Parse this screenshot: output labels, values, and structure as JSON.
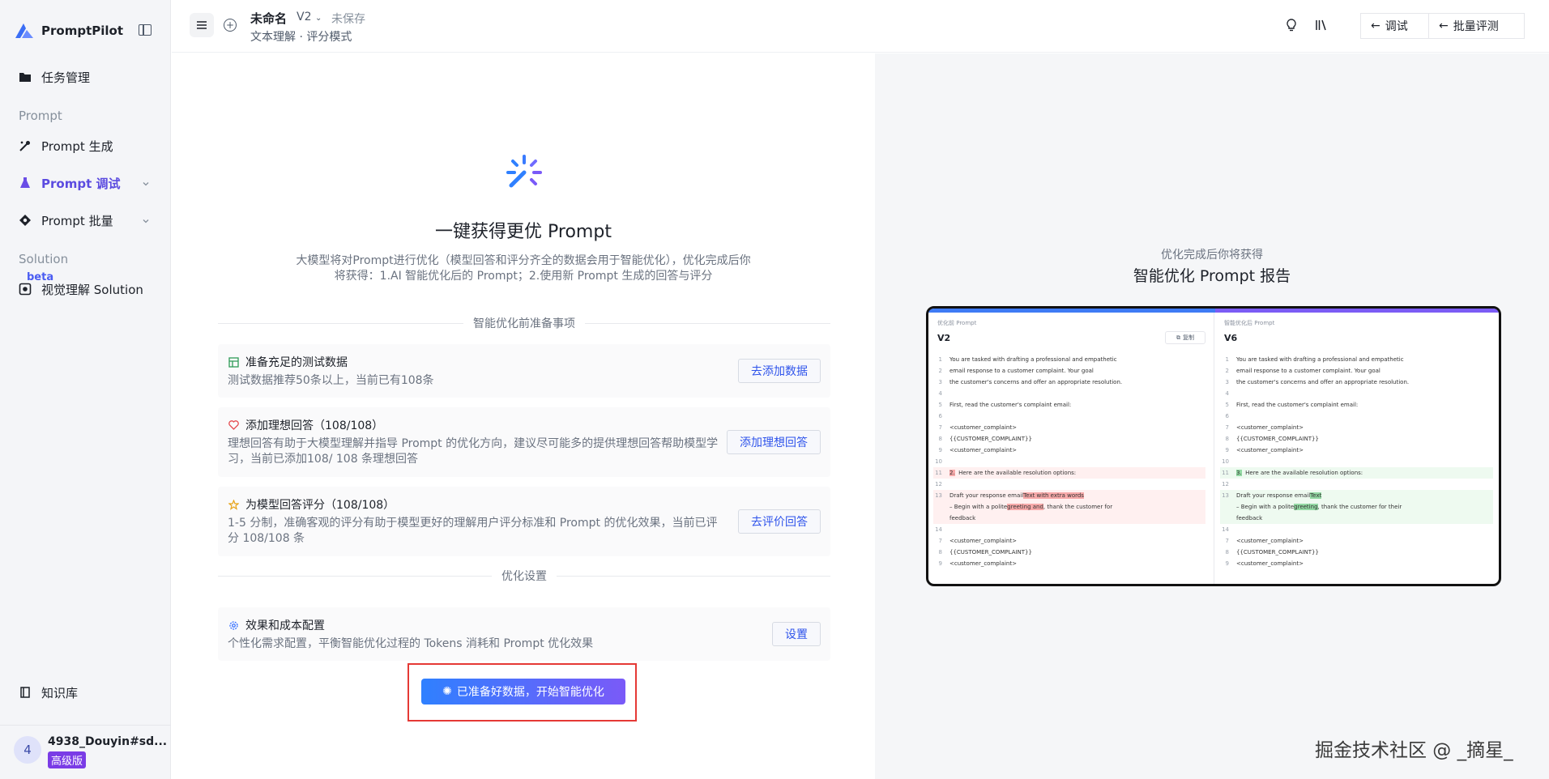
{
  "brand": {
    "name": "PromptPilot"
  },
  "sidebar": {
    "task_mgmt": "任务管理",
    "section_prompt": "Prompt",
    "prompt_generate": "Prompt 生成",
    "prompt_debug": "Prompt 调试",
    "prompt_batch": "Prompt 批量",
    "section_solution": "Solution",
    "beta": "beta",
    "vision_solution": "视觉理解 Solution",
    "knowledge_base": "知识库"
  },
  "user": {
    "avatar_initial": "4",
    "name": "4938_Douyin#sd...",
    "plan": "高级版"
  },
  "header": {
    "title": "未命名",
    "version": "V2",
    "status": "未保存",
    "mode": "文本理解 · 评分模式",
    "btn_debug": "调试",
    "btn_batch_eval": "批量评测"
  },
  "main": {
    "title": "一键获得更优 Prompt",
    "desc_line1": "大模型将对Prompt进行优化（模型回答和评分齐全的数据会用于智能优化），优化完成后你",
    "desc_line2": "将获得：1.AI 智能优化后的 Prompt；2.使用新 Prompt 生成的回答与评分",
    "prep_heading": "智能优化前准备事项",
    "cards": [
      {
        "title": "准备充足的测试数据",
        "desc": "测试数据推荐50条以上，当前已有108条",
        "button": "去添加数据"
      },
      {
        "title": "添加理想回答（108/108）",
        "desc": "理想回答有助于大模型理解并指导 Prompt 的优化方向，建议尽可能多的提供理想回答帮助模型学习，当前已添加108/ 108 条理想回答",
        "button": "添加理想回答"
      },
      {
        "title": "为模型回答评分（108/108）",
        "desc": "1-5 分制，准确客观的评分有助于模型更好的理解用户评分标准和 Prompt 的优化效果，当前已评分 108/108 条",
        "button": "去评价回答"
      }
    ],
    "settings_heading": "优化设置",
    "settings_card": {
      "title": "效果和成本配置",
      "desc": "个性化需求配置，平衡智能优化过程的 Tokens 消耗和 Prompt 优化效果",
      "button": "设置"
    },
    "cta": "已准备好数据，开始智能优化"
  },
  "right": {
    "subtitle": "优化完成后你将获得",
    "title": "智能优化 Prompt 报告",
    "preview": {
      "left_label": "优化前 Prompt",
      "left_version": "V2",
      "copy": "复制",
      "right_label": "智能优化后 Prompt",
      "right_version": "V6",
      "lines": {
        "l1": "You are tasked with drafting a professional and empathetic",
        "l2": "email response to a customer complaint. Your goal",
        "l3": "the customer's concerns and offer an appropriate resolution.",
        "l5": "First, read the customer's complaint email:",
        "l7": "<customer_complaint>",
        "l8": "{{CUSTOMER_COMPLAINT}}",
        "l9": "<customer_complaint>",
        "left_11_num": "2.",
        "right_11_num": "3.",
        "l11": "Here are the available resolution options:",
        "l13a": "Draft your response email",
        "left_13_mark": "Text with extra words",
        "right_13_mark": "Text",
        "l13b_pre": "– Begin with a polite",
        "left_13b_mark": "greeting and",
        "right_13b_mark": "greeting",
        "left_13b_post": ", thank the customer for",
        "right_13b_post": ", thank the customer for their",
        "l13c": "feedback"
      }
    }
  },
  "watermark": "掘金技术社区 @ _摘星_"
}
